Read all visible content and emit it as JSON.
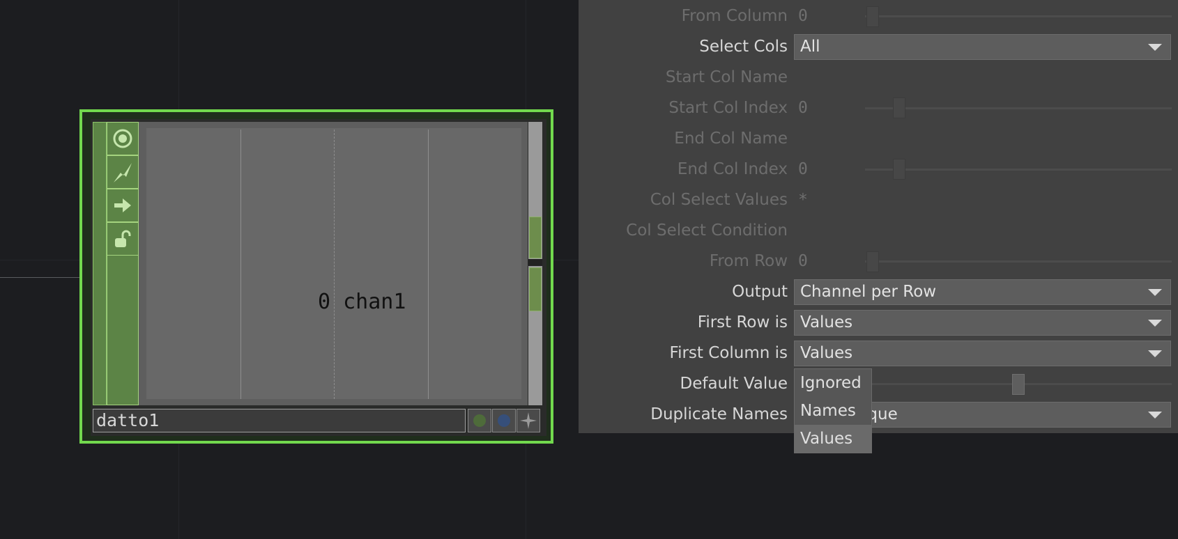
{
  "node": {
    "name": "datto1",
    "viewer_label": "0 chan1",
    "buttons": [
      "viewer-toggle-icon",
      "cook-icon",
      "export-icon",
      "lock-icon"
    ],
    "flag_colors": {
      "bypass": "#4e6b3a",
      "display": "#364f7a",
      "accent": "#72d94e"
    }
  },
  "params": {
    "from_column": {
      "label": "From Column",
      "value": "0"
    },
    "select_cols": {
      "label": "Select Cols",
      "value": "All"
    },
    "start_col_name": {
      "label": "Start Col Name"
    },
    "start_col_index": {
      "label": "Start Col Index",
      "value": "0"
    },
    "end_col_name": {
      "label": "End Col Name"
    },
    "end_col_index": {
      "label": "End Col Index",
      "value": "0"
    },
    "col_select_values": {
      "label": "Col Select Values",
      "value": "*"
    },
    "col_select_condition": {
      "label": "Col Select Condition"
    },
    "from_row": {
      "label": "From Row",
      "value": "0"
    },
    "output": {
      "label": "Output",
      "value": "Channel per Row"
    },
    "first_row_is": {
      "label": "First Row is",
      "value": "Values"
    },
    "first_column_is": {
      "label": "First Column is",
      "value": "Values"
    },
    "default_value": {
      "label": "Default Value"
    },
    "duplicate_names": {
      "label": "Duplicate Names",
      "value_visible": "ique"
    }
  },
  "menu": {
    "items": [
      "Ignored",
      "Names",
      "Values"
    ],
    "selected": "Values"
  }
}
